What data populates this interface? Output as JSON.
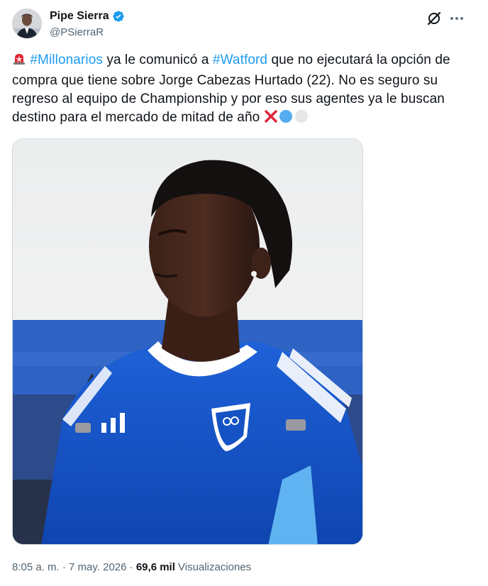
{
  "author": {
    "name": "Pipe Sierra",
    "handle": "@PSierraR",
    "verified": true,
    "avatar_icon": "person-avatar"
  },
  "header_actions": {
    "grok_icon": "grok-icon",
    "more_icon": "more-horizontal-icon"
  },
  "tweet": {
    "emoji_siren": "siren-emoji",
    "hashtag_1": "#Millonarios",
    "text_1": " ya le comunicó a ",
    "hashtag_2": "#Watford",
    "text_2": " que no ejecutará la opción de compra que tiene sobre Jorge Cabezas Hurtado (22). No es seguro su regreso al equipo de Championship y por eso sus agentes ya le buscan destino para el mercado de mitad de año ",
    "trailing_emojis": [
      "cross-mark-emoji",
      "blue-circle-emoji",
      "white-circle-emoji"
    ]
  },
  "media": {
    "type": "photo",
    "subject": "football-player-photo"
  },
  "meta": {
    "time": "8:05 a. m.",
    "sep_1": " · ",
    "date": "7 may. 2026",
    "sep_2": " · ",
    "views_count": "69,6 mil",
    "views_label": " Visualizaciones"
  },
  "colors": {
    "accent": "#1d9bf0",
    "text": "#0f1419",
    "secondary": "#536471",
    "border": "#cfd9de",
    "jersey": "#1553c4"
  }
}
